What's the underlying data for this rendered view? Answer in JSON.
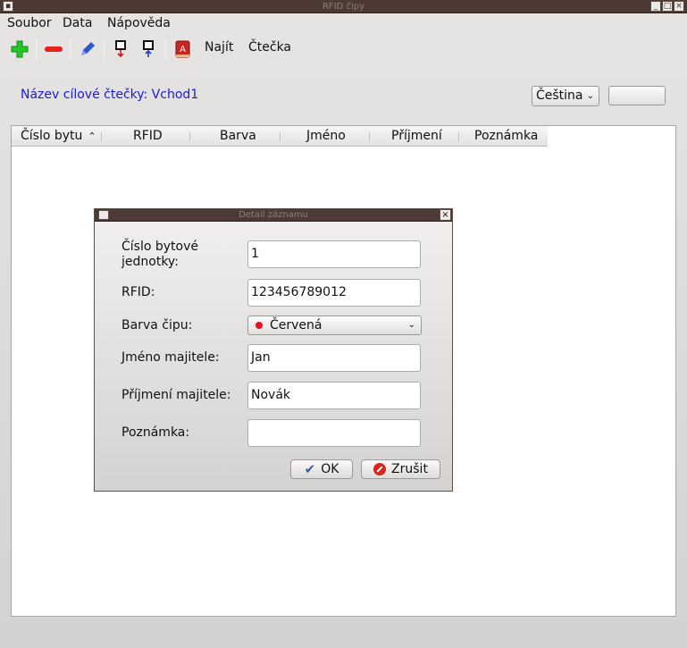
{
  "window": {
    "title": "RFID čipy"
  },
  "menu": {
    "file": "Soubor",
    "data": "Data",
    "help": "Nápověda"
  },
  "toolbar": {
    "find_label": "Najít",
    "reader_label": "Čtečka"
  },
  "icons": {
    "add": "plus-icon",
    "remove": "minus-icon",
    "edit": "pen-icon",
    "card_down": "card-down-icon",
    "card_up": "card-up-icon",
    "dictionary": "dictionary-icon"
  },
  "colors": {
    "add": "#22c82a",
    "remove": "#e61f1f",
    "edit": "#2c57c8",
    "reader_link": "#1a1adf",
    "chip_red": "#e8141a"
  },
  "reader": {
    "label": "Název cílové čtečky: Vchod1"
  },
  "language": {
    "selected": "Čeština"
  },
  "table": {
    "columns": [
      "Číslo bytu",
      "RFID",
      "Barva",
      "Jméno",
      "Příjmení",
      "Poznámka"
    ]
  },
  "dialog": {
    "title": "Detail záznamu",
    "fields": {
      "unit_label_line1": "Číslo bytové",
      "unit_label_line2": "jednotky:",
      "unit_value": "1",
      "rfid_label": "RFID:",
      "rfid_value": "123456789012",
      "color_label": "Barva čipu:",
      "color_value": "Červená",
      "first_name_label": "Jméno majitele:",
      "first_name_value": "Jan",
      "last_name_label": "Příjmení majitele:",
      "last_name_value": "Novák",
      "note_label": "Poznámka:",
      "note_value": ""
    },
    "ok_label": "OK",
    "cancel_label": "Zrušit"
  }
}
